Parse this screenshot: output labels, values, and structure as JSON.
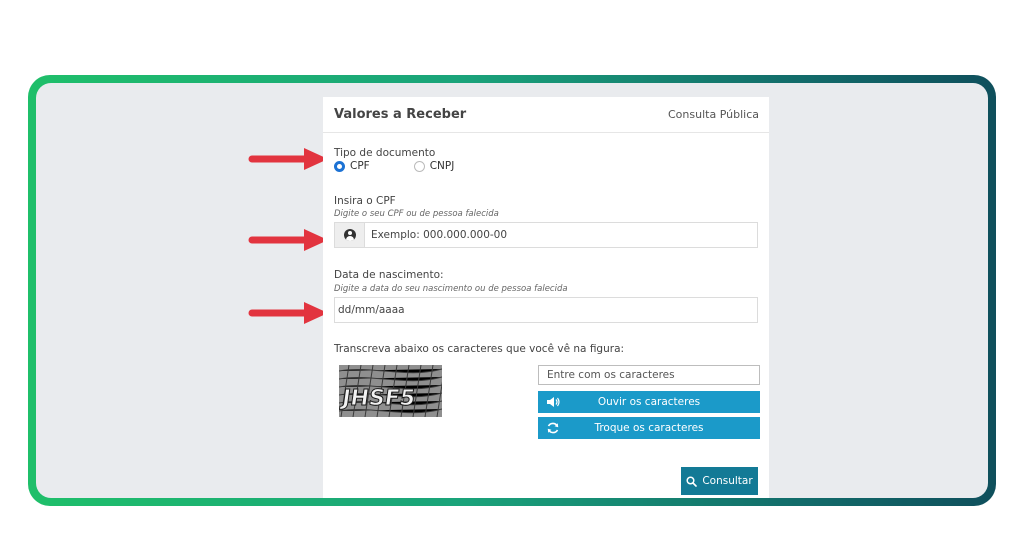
{
  "card": {
    "title": "Valores a Receber",
    "subtitle": "Consulta Pública"
  },
  "doc_type": {
    "label": "Tipo de documento",
    "options": [
      {
        "label": "CPF",
        "selected": true
      },
      {
        "label": "CNPJ",
        "selected": false
      }
    ]
  },
  "cpf": {
    "label": "Insira o CPF",
    "hint": "Digite o seu CPF ou de pessoa falecida",
    "placeholder": "Exemplo: 000.000.000-00",
    "icon": "user-circle-icon"
  },
  "birth": {
    "label": "Data de nascimento:",
    "hint": "Digite a data do seu nascimento ou de pessoa falecida",
    "placeholder": "dd/mm/aaaa"
  },
  "captcha": {
    "label": "Transcreva abaixo os caracteres que você vê na figura:",
    "image_text": "JHSF5",
    "input_placeholder": "Entre com os caracteres",
    "listen_label": "Ouvir os caracteres",
    "refresh_label": "Troque os caracteres",
    "listen_icon": "speaker-icon",
    "refresh_icon": "refresh-icon"
  },
  "submit": {
    "label": "Consultar",
    "icon": "search-icon"
  },
  "colors": {
    "frame_gradient_start": "#1fbf6a",
    "frame_gradient_end": "#0f4f5c",
    "radio_selected": "#1c72d4",
    "button_blue": "#1b9ac9",
    "button_submit": "#137a96",
    "arrow_red": "#e2343f"
  }
}
